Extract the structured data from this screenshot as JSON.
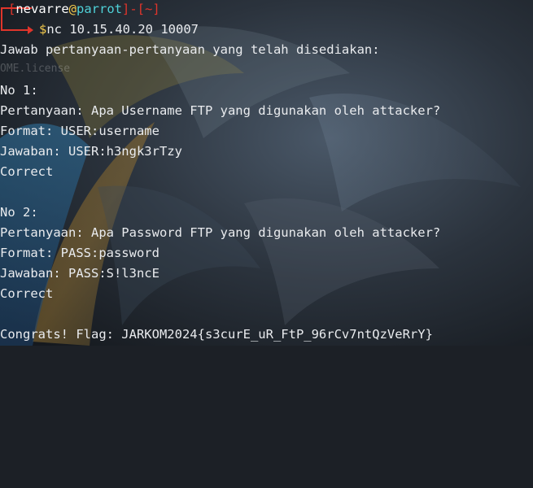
{
  "prompt": {
    "user": "nevarre",
    "at": "@",
    "host": "parrot",
    "dash": "]-[",
    "tilde": "~",
    "close": "]",
    "dollar": "$",
    "command": "nc 10.15.40.20 10007"
  },
  "output": {
    "intro": "Jawab pertanyaan-pertanyaan yang telah disediakan:",
    "ghost_text": "OME.license",
    "q1": {
      "number": "No 1:",
      "question": "Pertanyaan: Apa Username FTP yang digunakan oleh attacker?",
      "format": "Format: USER:username",
      "answer": "Jawaban: USER:h3ngk3rTzy",
      "result": "Correct"
    },
    "q2": {
      "number": "No 2:",
      "question": "Pertanyaan: Apa Password FTP yang digunakan oleh attacker?",
      "format": "Format: PASS:password",
      "answer": "Jawaban: PASS:S!l3ncE",
      "result": "Correct"
    },
    "flag": "Congrats! Flag: JARKOM2024{s3curE_uR_FtP_96rCv7ntQzVeRrY}"
  },
  "colors": {
    "text": "#e9ebee",
    "prompt_red": "#e0352b",
    "prompt_yellow": "#f2c94c",
    "prompt_cyan": "#4fd2d9",
    "background": "#1c2026"
  }
}
